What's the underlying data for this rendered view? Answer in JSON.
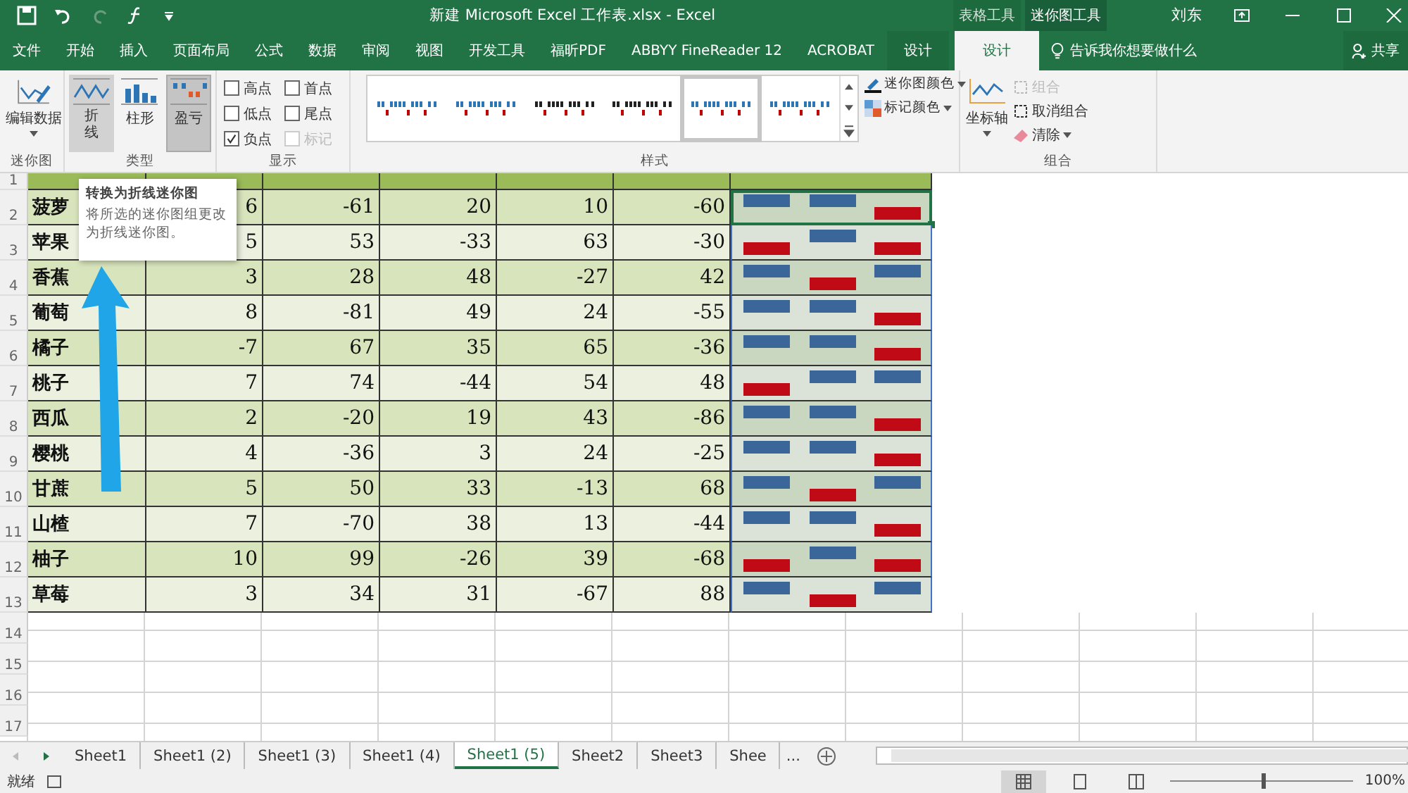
{
  "window": {
    "title": "新建 Microsoft Excel 工作表.xlsx  -  Excel",
    "context_groups": [
      {
        "label": "表格工具",
        "selected": false
      },
      {
        "label": "迷你图工具",
        "selected": true
      }
    ],
    "user": "刘东"
  },
  "tabs": [
    {
      "label": "文件",
      "selected": false,
      "context": false
    },
    {
      "label": "开始",
      "selected": false,
      "context": false
    },
    {
      "label": "插入",
      "selected": false,
      "context": false
    },
    {
      "label": "页面布局",
      "selected": false,
      "context": false
    },
    {
      "label": "公式",
      "selected": false,
      "context": false
    },
    {
      "label": "数据",
      "selected": false,
      "context": false
    },
    {
      "label": "审阅",
      "selected": false,
      "context": false
    },
    {
      "label": "视图",
      "selected": false,
      "context": false
    },
    {
      "label": "开发工具",
      "selected": false,
      "context": false
    },
    {
      "label": "福昕PDF",
      "selected": false,
      "context": false
    },
    {
      "label": "ABBYY FineReader 12",
      "selected": false,
      "context": false
    },
    {
      "label": "ACROBAT",
      "selected": false,
      "context": false
    },
    {
      "label": "设计",
      "selected": false,
      "context": true
    },
    {
      "label": "设计",
      "selected": true,
      "context": true
    }
  ],
  "tell_me": "告诉我你想要做什么",
  "share": "共享",
  "ribbon": {
    "sparkline_group": {
      "button": "编辑数据",
      "label": "迷你图"
    },
    "type_group": {
      "label": "类型",
      "types": [
        {
          "label": "折线",
          "kind": "line",
          "selected": false,
          "hovered": true
        },
        {
          "label": "柱形",
          "kind": "column",
          "selected": false,
          "hovered": false
        },
        {
          "label": "盈亏",
          "kind": "winloss",
          "selected": true,
          "hovered": false
        }
      ]
    },
    "show_group": {
      "label": "显示",
      "options": [
        {
          "label": "高点",
          "checked": false,
          "disabled": false
        },
        {
          "label": "首点",
          "checked": false,
          "disabled": false
        },
        {
          "label": "低点",
          "checked": false,
          "disabled": false
        },
        {
          "label": "尾点",
          "checked": false,
          "disabled": false
        },
        {
          "label": "负点",
          "checked": true,
          "disabled": false
        },
        {
          "label": "标记",
          "checked": false,
          "disabled": true
        }
      ]
    },
    "style_group": {
      "label": "样式",
      "styles": [
        {
          "color": "#2e75b6",
          "selected": false
        },
        {
          "color": "#2e75b6",
          "selected": false
        },
        {
          "color": "#222222",
          "selected": false
        },
        {
          "color": "#222222",
          "selected": false
        },
        {
          "color": "#2e75b6",
          "selected": true
        },
        {
          "color": "#2e75b6",
          "selected": false
        }
      ],
      "sparkline_color": "迷你图颜色",
      "marker_color": "标记颜色"
    },
    "group_group": {
      "label": "组合",
      "axis": "坐标轴",
      "buttons": [
        {
          "label": "组合",
          "disabled": true,
          "kind": "group"
        },
        {
          "label": "取消组合",
          "disabled": false,
          "kind": "ungroup"
        },
        {
          "label": "清除",
          "disabled": false,
          "kind": "clear"
        }
      ]
    }
  },
  "tooltip": {
    "title": "转换为折线迷你图",
    "text": "将所选的迷你图组更改为折线迷你图。"
  },
  "sheet": {
    "row_numbers": [
      "1",
      "2",
      "3",
      "4",
      "5",
      "6",
      "7",
      "8",
      "9",
      "10",
      "11",
      "12",
      "13",
      "14",
      "15",
      "16",
      "17"
    ],
    "rows": [
      {
        "name": "菠萝",
        "values": [
          "6",
          "-61",
          "20",
          "10",
          "-60"
        ],
        "sparkline": [
          {
            "positive": true
          },
          {
            "positive": true
          },
          {
            "positive": false
          }
        ],
        "selected": true
      },
      {
        "name": "苹果",
        "values": [
          "5",
          "53",
          "-33",
          "63",
          "-30"
        ],
        "sparkline": [
          {
            "positive": false
          },
          {
            "positive": true
          },
          {
            "positive": false
          }
        ],
        "selected": false
      },
      {
        "name": "香蕉",
        "values": [
          "3",
          "28",
          "48",
          "-27",
          "42"
        ],
        "sparkline": [
          {
            "positive": true
          },
          {
            "positive": false
          },
          {
            "positive": true
          }
        ],
        "selected": false
      },
      {
        "name": "葡萄",
        "values": [
          "8",
          "-81",
          "49",
          "24",
          "-55"
        ],
        "sparkline": [
          {
            "positive": true
          },
          {
            "positive": true
          },
          {
            "positive": false
          }
        ],
        "selected": false
      },
      {
        "name": "橘子",
        "values": [
          "-7",
          "67",
          "35",
          "65",
          "-36"
        ],
        "sparkline": [
          {
            "positive": true
          },
          {
            "positive": true
          },
          {
            "positive": false
          }
        ],
        "selected": false
      },
      {
        "name": "桃子",
        "values": [
          "7",
          "74",
          "-44",
          "54",
          "48"
        ],
        "sparkline": [
          {
            "positive": false
          },
          {
            "positive": true
          },
          {
            "positive": true
          }
        ],
        "selected": false
      },
      {
        "name": "西瓜",
        "values": [
          "2",
          "-20",
          "19",
          "43",
          "-86"
        ],
        "sparkline": [
          {
            "positive": true
          },
          {
            "positive": true
          },
          {
            "positive": false
          }
        ],
        "selected": false
      },
      {
        "name": "樱桃",
        "values": [
          "4",
          "-36",
          "3",
          "24",
          "-25"
        ],
        "sparkline": [
          {
            "positive": true
          },
          {
            "positive": true
          },
          {
            "positive": false
          }
        ],
        "selected": false
      },
      {
        "name": "甘蔗",
        "values": [
          "5",
          "50",
          "33",
          "-13",
          "68"
        ],
        "sparkline": [
          {
            "positive": true
          },
          {
            "positive": false
          },
          {
            "positive": true
          }
        ],
        "selected": false
      },
      {
        "name": "山楂",
        "values": [
          "7",
          "-70",
          "38",
          "13",
          "-44"
        ],
        "sparkline": [
          {
            "positive": true
          },
          {
            "positive": true
          },
          {
            "positive": false
          }
        ],
        "selected": false
      },
      {
        "name": "柚子",
        "values": [
          "10",
          "99",
          "-26",
          "39",
          "-68"
        ],
        "sparkline": [
          {
            "positive": false
          },
          {
            "positive": true
          },
          {
            "positive": false
          }
        ],
        "selected": false
      },
      {
        "name": "草莓",
        "values": [
          "3",
          "34",
          "31",
          "-67",
          "88"
        ],
        "sparkline": [
          {
            "positive": true
          },
          {
            "positive": false
          },
          {
            "positive": true
          }
        ],
        "selected": false
      }
    ]
  },
  "sheet_tabs": [
    {
      "label": "Sheet1",
      "selected": false
    },
    {
      "label": "Sheet1 (2)",
      "selected": false
    },
    {
      "label": "Sheet1 (3)",
      "selected": false
    },
    {
      "label": "Sheet1 (4)",
      "selected": false
    },
    {
      "label": "Sheet1 (5)",
      "selected": true
    },
    {
      "label": "Sheet2",
      "selected": false
    },
    {
      "label": "Sheet3",
      "selected": false
    },
    {
      "label": "Shee",
      "selected": false
    }
  ],
  "more_tabs": "...",
  "status_bar": {
    "status": "就绪",
    "zoom": "100%",
    "zoom_slider": {
      "level": 0.5
    }
  }
}
